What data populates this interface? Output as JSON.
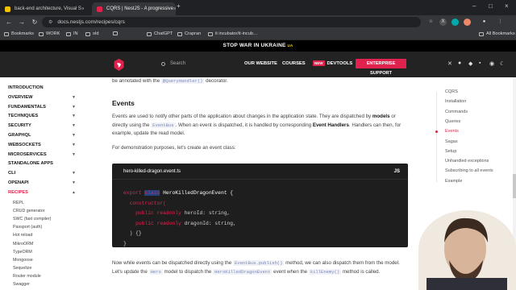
{
  "tabs": [
    {
      "title": "back-end architecture, Visual S",
      "color": "#f5c400"
    },
    {
      "title": "CQRS | NestJS - A progressive",
      "color": "#e0234e"
    }
  ],
  "new_tab": "+",
  "url": "docs.nestjs.com/recipes/cqrs",
  "bookmarks": [
    "Bookmarks",
    "WORK",
    "IN",
    "old",
    "",
    "ChatGPT",
    "Crapran",
    "it incubator/it-incub…",
    "All Bookmarks"
  ],
  "banner": "STOP WAR IN UKRAINE",
  "banner_flag": "UA",
  "header": {
    "search_placeholder": "Search",
    "nav": [
      "OUR WEBSITE",
      "COURSES",
      "DEVTOOLS"
    ],
    "new_badge": "NEW",
    "enterprise": "ENTERPRISE SUPPORT"
  },
  "sidebar": {
    "items": [
      "INTRODUCTION",
      "OVERVIEW",
      "FUNDAMENTALS",
      "TECHNIQUES",
      "SECURITY",
      "GRAPHQL",
      "WEBSOCKETS",
      "MICROSERVICES",
      "STANDALONE APPS",
      "CLI",
      "OPENAPI",
      "RECIPES"
    ],
    "has_chevron": [
      false,
      true,
      true,
      true,
      true,
      true,
      true,
      true,
      false,
      true,
      true,
      true
    ],
    "sub_items": [
      "REPL",
      "CRUD generator",
      "SWC (fast compiler)",
      "Passport (auth)",
      "Hot reload",
      "MikroORM",
      "TypeORM",
      "Mongoose",
      "Sequelize",
      "Router module",
      "Swagger"
    ]
  },
  "content": {
    "line0_pre": "be annotated with the",
    "line0_code": "@QueryHandler()",
    "line0_post": "decorator.",
    "heading": "Events",
    "p1a": "Events are used to notify other parts of the application about changes in the application state. They are dispatched by",
    "p1_bold1": "models",
    "p1_or": "or",
    "p1b": "directly using the",
    "p1_code": "EventBus",
    "p1c": ". When an event is dispatched, it is handled by corresponding",
    "p1_bold2": "Event Handlers",
    "p1d": ". Handlers can then, for",
    "p1e": "example, update the read model.",
    "p2": "For demonstration purposes, let's create an event class:",
    "code_file": "hero-killed-dragon.event.ts",
    "code_lang": "JS",
    "code_l1_kw1": "export",
    "code_l1_kw2": "class",
    "code_l1_name": "HeroKilledDragonEvent {",
    "code_l2": "constructor(",
    "code_l3_kw": "public readonly",
    "code_l3_rest": "heroId: string,",
    "code_l4_kw": "public readonly",
    "code_l4_rest": "dragonId: string,",
    "code_l5": ") {}",
    "code_l6": "}",
    "p3a": "Now while events can be dispatched directly using the",
    "p3_code1": "EventBus.publish()",
    "p3b": "method, we can also dispatch them from the model.",
    "p3c": "Let's update the",
    "p3_code2": "Hero",
    "p3d": "model to dispatch the",
    "p3_code3": "HeroKilledDragonEvent",
    "p3e": "event when the",
    "p3_code4": "killEnemy()",
    "p3f": "method is called."
  },
  "toc": [
    "CQRS",
    "Installation",
    "Commands",
    "Queries",
    "Events",
    "Sagas",
    "Setup",
    "Unhandled exceptions",
    "Subscribing to all events",
    "Example"
  ],
  "toc_active": 4,
  "colors": {
    "accent": "#e0234e",
    "header_bg": "#232323",
    "code_bg": "#1e1e1e"
  }
}
